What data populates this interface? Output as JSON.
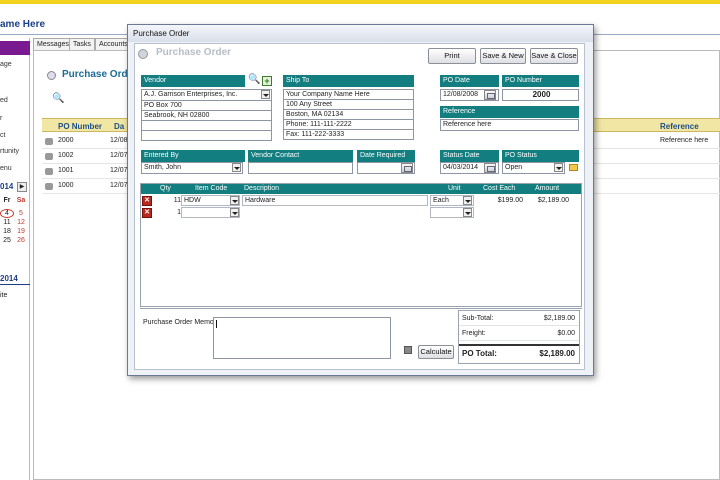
{
  "app": {
    "title": "ame Here",
    "nav": [
      "",
      "age",
      "",
      "ed",
      "",
      "r",
      "ct",
      "rtunity",
      "enu"
    ],
    "calendar": {
      "year_label": "014",
      "days": [
        "Fr",
        "Sa"
      ],
      "rows": [
        [
          "4",
          "5"
        ],
        [
          "11",
          "12"
        ],
        [
          "18",
          "19"
        ],
        [
          "25",
          "26"
        ]
      ],
      "year_label2": "2014",
      "footer": "ite"
    },
    "tabs": [
      "Messages",
      "Tasks",
      "Accounts"
    ],
    "list": {
      "title": "Purchase Order",
      "columns": [
        "PO Number",
        "Da",
        "Reference"
      ],
      "rows": [
        {
          "po": "2000",
          "date": "12/08",
          "ref": "Reference here"
        },
        {
          "po": "1002",
          "date": "12/07",
          "ref": ""
        },
        {
          "po": "1001",
          "date": "12/07",
          "ref": ""
        },
        {
          "po": "1000",
          "date": "12/07",
          "ref": ""
        }
      ]
    }
  },
  "dialog": {
    "window_title": "Purchase Order",
    "header_title": "Purchase Order",
    "buttons": {
      "print": "Print",
      "save_new": "Save & New",
      "save_close": "Save & Close"
    },
    "vendor": {
      "label": "Vendor",
      "name": "A.J. Garrison Enterprises, Inc.",
      "address": [
        "PO Box 700",
        "Seabrook, NH 02800",
        ""
      ]
    },
    "ship_to": {
      "label": "Ship To",
      "lines": [
        "Your Company Name Here",
        "100 Any Street",
        "Boston, MA 02134",
        "Phone:  111-111-2222",
        "Fax:    111-222-3333"
      ]
    },
    "po_date": {
      "label": "PO Date",
      "value": "12/08/2008"
    },
    "po_number": {
      "label": "PO Number",
      "value": "2000"
    },
    "reference": {
      "label": "Reference",
      "value": "Reference here"
    },
    "entered_by": {
      "label": "Entered By",
      "value": "Smith, John"
    },
    "vendor_contact": {
      "label": "Vendor Contact",
      "value": ""
    },
    "date_required": {
      "label": "Date Required",
      "value": ""
    },
    "status_date": {
      "label": "Status Date",
      "value": "04/03/2014"
    },
    "po_status": {
      "label": "PO Status",
      "value": "Open"
    },
    "grid": {
      "columns": {
        "qty": "Qty",
        "item_code": "Item Code",
        "description": "Description",
        "unit": "Unit",
        "cost_each": "Cost Each",
        "amount": "Amount"
      },
      "rows": [
        {
          "qty": "11",
          "item_code": "HDW",
          "description": "Hardware",
          "unit": "Each",
          "cost": "$199.00",
          "amount": "$2,189.00"
        },
        {
          "qty": "1",
          "item_code": "",
          "description": "",
          "unit": "",
          "cost": "",
          "amount": ""
        }
      ]
    },
    "memo_label": "Purchase Order Memo:",
    "calculate": "Calculate",
    "totals": {
      "subtotal_label": "Sub-Total:",
      "subtotal": "$2,189.00",
      "freight_label": "Freight:",
      "freight": "$0.00",
      "total_label": "PO Total:",
      "total": "$2,189.00"
    }
  }
}
